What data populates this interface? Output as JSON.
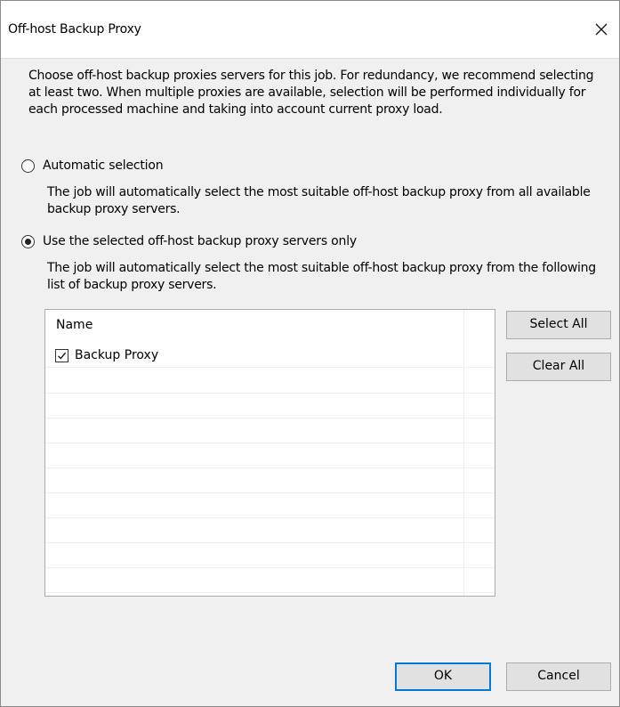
{
  "window": {
    "title": "Off-host Backup Proxy"
  },
  "intro_text": "Choose off-host backup proxies servers for this job. For redundancy, we recommend selecting at least two. When multiple proxies are available, selection will be performed individually for each processed machine and taking into account current proxy load.",
  "options": [
    {
      "label": "Automatic selection",
      "selected": false,
      "description": "The job will automatically select the most suitable off-host backup proxy from all available backup proxy servers."
    },
    {
      "label": "Use the selected off-host backup proxy servers only",
      "selected": true,
      "description": "The job will automatically select the most suitable off-host backup proxy from the following list of backup proxy servers."
    }
  ],
  "proxy_list": {
    "column_header": "Name",
    "items": [
      {
        "name": "Backup Proxy",
        "checked": true
      }
    ]
  },
  "buttons": {
    "select_all": "Select All",
    "clear_all": "Clear All",
    "ok": "OK",
    "cancel": "Cancel"
  },
  "icons": {
    "close": "close-icon",
    "checkmark": "checkmark-icon"
  },
  "colors": {
    "dialog_bg": "#f0f0f0",
    "button_bg": "#e1e1e1",
    "default_button_border": "#0078d7"
  }
}
